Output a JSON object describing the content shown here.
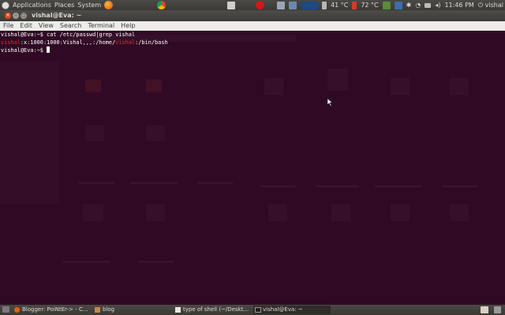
{
  "top_panel": {
    "menus": [
      "Applications",
      "Places",
      "System"
    ],
    "temp1": "41 °C",
    "temp2": "72 °C",
    "time": "11:46 PM",
    "user": "vishal"
  },
  "window": {
    "title": "vishal@Eva: ~",
    "menu": [
      "File",
      "Edit",
      "View",
      "Search",
      "Terminal",
      "Help"
    ]
  },
  "terminal": {
    "line1": "vishal@Eva:~$ cat /etc/passwd|grep vishal",
    "line2_user": "vishal",
    "line2_mid": ":x:1000:1000:Vishal,,,:/home/",
    "line2_user2": "vishal",
    "line2_end": ":/bin/bash",
    "line3": "vishal@Eva:~$ "
  },
  "taskbar": {
    "items": [
      "Blogger: PoiNtEr-> - C...",
      "blog",
      "type of shell (~/Deskt...",
      "vishal@Eva: ~"
    ]
  },
  "colors": {
    "terminal_bg": "#300a24",
    "panel": "#3c3b37",
    "highlight": "#ef2929"
  }
}
